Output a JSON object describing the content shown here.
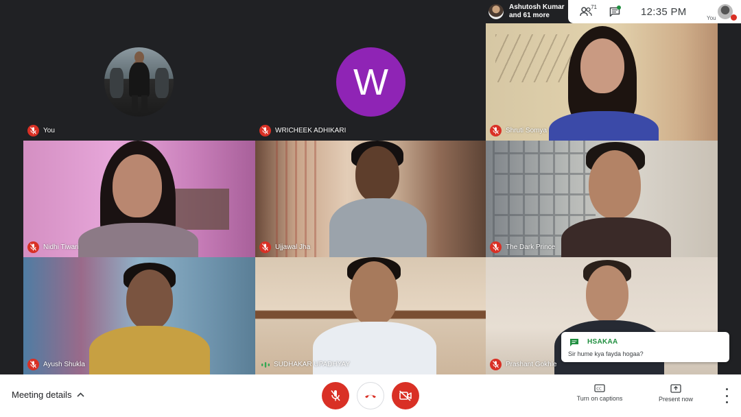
{
  "topbar": {
    "presenter_line1": "Ashutosh Kumar",
    "presenter_line2": "and 61 more",
    "participant_count": "71",
    "clock": "12:35 PM",
    "self_label": "You"
  },
  "tiles": [
    {
      "name": "You",
      "mic": "muted",
      "kind": "photo-avatar"
    },
    {
      "name": "WRICHEEK ADHIKARI",
      "mic": "muted",
      "kind": "letter-avatar",
      "letter": "W",
      "avatar_color": "#8f24b5"
    },
    {
      "name": "Shruti Somya",
      "mic": "muted",
      "kind": "video"
    },
    {
      "name": "Nidhi Tiwari",
      "mic": "muted",
      "kind": "video"
    },
    {
      "name": "Ujjawal Jha",
      "mic": "muted",
      "kind": "video"
    },
    {
      "name": "The Dark Prince",
      "mic": "muted",
      "kind": "video"
    },
    {
      "name": "Ayush Shukla",
      "mic": "muted",
      "kind": "video"
    },
    {
      "name": "SUDHAKAR UPADHYAY",
      "mic": "speaking",
      "kind": "video"
    },
    {
      "name": "Prashant Gokhle",
      "mic": "muted",
      "kind": "video"
    }
  ],
  "chat_toast": {
    "sender": "HSAKAA",
    "message": "Sir hume kya fayda hogaa?"
  },
  "bottombar": {
    "meeting_details": "Meeting details",
    "captions_label": "Turn on captions",
    "present_label": "Present now"
  },
  "colors": {
    "background": "#202124",
    "danger": "#d93025",
    "chat_green": "#1e8e3e"
  },
  "icons": [
    "people-icon",
    "chat-icon",
    "mic-off-icon",
    "hangup-icon",
    "camera-off-icon",
    "captions-icon",
    "present-icon",
    "more-vert-icon",
    "chevron-up-icon",
    "audio-level-icon"
  ]
}
